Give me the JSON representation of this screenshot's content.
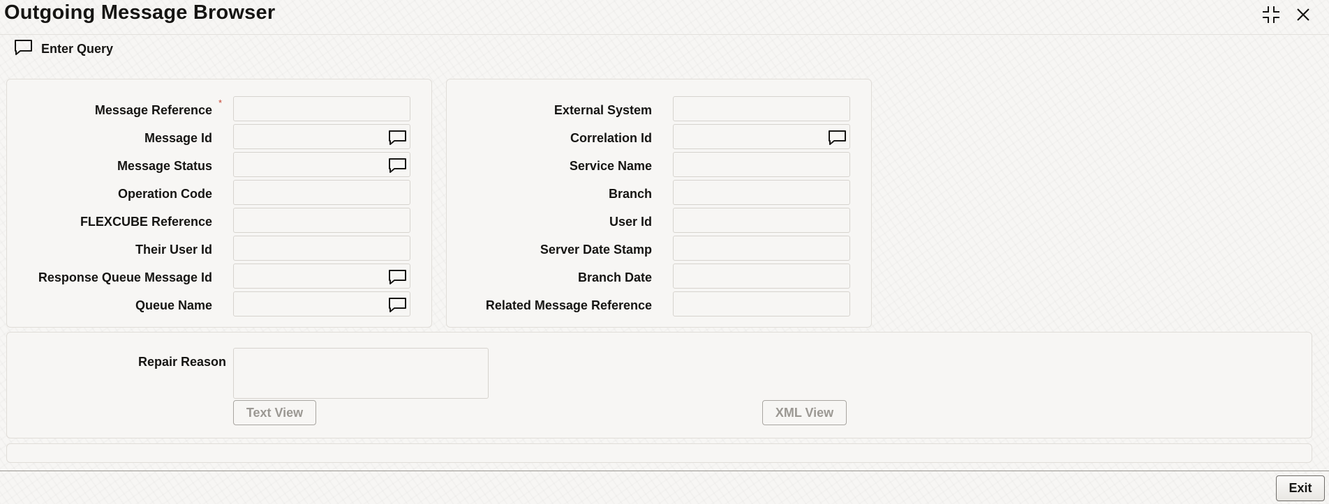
{
  "window": {
    "title": "Outgoing Message Browser",
    "controls": [
      {
        "name": "minimize-icon"
      },
      {
        "name": "close-icon"
      }
    ]
  },
  "toolbar": {
    "enter_query_label": "Enter Query",
    "icon": "chat-bubble-icon"
  },
  "left_panel": {
    "fields": [
      {
        "label": "Message Reference",
        "value": "",
        "required": true,
        "lov": false
      },
      {
        "label": "Message Id",
        "value": "",
        "required": false,
        "lov": true
      },
      {
        "label": "Message Status",
        "value": "",
        "required": false,
        "lov": true
      },
      {
        "label": "Operation Code",
        "value": "",
        "required": false,
        "lov": false
      },
      {
        "label": "FLEXCUBE Reference",
        "value": "",
        "required": false,
        "lov": false
      },
      {
        "label": "Their User Id",
        "value": "",
        "required": false,
        "lov": false
      },
      {
        "label": "Response Queue Message Id",
        "value": "",
        "required": false,
        "lov": true
      },
      {
        "label": "Queue Name",
        "value": "",
        "required": false,
        "lov": true
      }
    ],
    "required_marker": "*"
  },
  "right_panel": {
    "fields": [
      {
        "label": "External System",
        "value": "",
        "lov": false
      },
      {
        "label": "Correlation Id",
        "value": "",
        "lov": true
      },
      {
        "label": "Service Name",
        "value": "",
        "lov": false
      },
      {
        "label": "Branch",
        "value": "",
        "lov": false
      },
      {
        "label": "User Id",
        "value": "",
        "lov": false
      },
      {
        "label": "Server Date Stamp",
        "value": "",
        "lov": false
      },
      {
        "label": "Branch Date",
        "value": "",
        "lov": false
      },
      {
        "label": "Related Message Reference",
        "value": "",
        "lov": false
      }
    ]
  },
  "repair": {
    "label": "Repair Reason",
    "value": "",
    "text_view_label": "Text View",
    "xml_view_label": "XML View"
  },
  "footer": {
    "exit_label": "Exit"
  },
  "colors": {
    "background": "#f7f6f4",
    "text": "#161513",
    "required": "#c74634",
    "disabled_text": "#9b9893"
  }
}
